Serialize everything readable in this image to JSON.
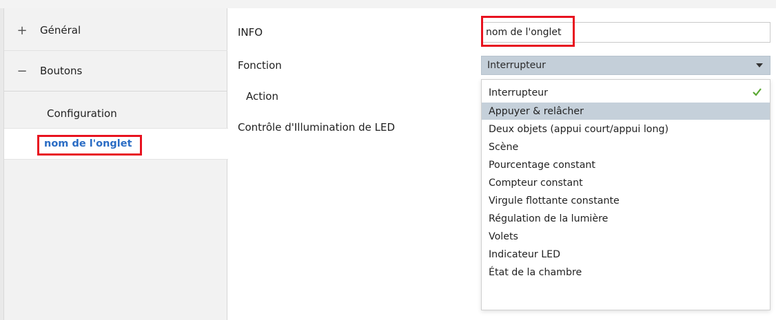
{
  "colors": {
    "link": "#2a6cc4",
    "highlight_box": "#e8121f",
    "select_bg": "#c4cfd9",
    "option_highlight": "#c5d0da",
    "check": "#5aa832"
  },
  "tree": {
    "general": {
      "symbol": "+",
      "label": "Général"
    },
    "boutons": {
      "symbol": "−",
      "label": "Boutons"
    },
    "children": [
      {
        "label": "Configuration"
      },
      {
        "label": "nom de l'onglet"
      }
    ]
  },
  "params": {
    "info_label": "INFO",
    "fonction_label": "Fonction",
    "action_label": "Action",
    "led_label": "Contrôle d'Illumination de LED"
  },
  "info_field": {
    "value": "nom de l'onglet"
  },
  "fonction_select": {
    "selected": "Interrupteur",
    "options": [
      {
        "label": "Interrupteur",
        "checked": true
      },
      {
        "label": "Appuyer & relâcher",
        "hovered": true
      },
      {
        "label": "Deux objets (appui court/appui long)"
      },
      {
        "label": "Scène"
      },
      {
        "label": "Pourcentage constant"
      },
      {
        "label": "Compteur constant"
      },
      {
        "label": "Virgule flottante constante"
      },
      {
        "label": "Régulation de la lumière"
      },
      {
        "label": "Volets"
      },
      {
        "label": "Indicateur LED"
      },
      {
        "label": "État de la chambre"
      }
    ]
  }
}
